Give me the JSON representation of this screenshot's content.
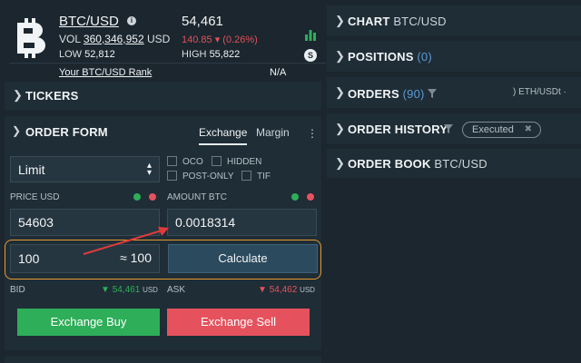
{
  "ticker": {
    "pair": "BTC/USD",
    "price": "54,461",
    "vol_label": "VOL",
    "vol_value": "360,346,952",
    "vol_unit": "USD",
    "change": "140.85 ▾ (0.26%)",
    "low_label": "LOW",
    "low_value": "52,812",
    "high_label": "HIGH",
    "high_value": "55,822",
    "rank_label": "Your BTC/USD Rank",
    "rank_value": "N/A",
    "s_icon": "S"
  },
  "tickers": {
    "title": "TICKERS"
  },
  "order_form": {
    "title": "ORDER FORM",
    "tabs": [
      "Exchange",
      "Margin"
    ],
    "order_type": "Limit",
    "options": [
      "OCO",
      "HIDDEN",
      "POST-ONLY",
      "TIF"
    ],
    "price_label": "PRICE USD",
    "price_value": "54603",
    "amount_label": "AMOUNT BTC",
    "amount_value": "0.0018314",
    "total_value": "100",
    "total_approx": "≈ 100",
    "calculate_label": "Calculate",
    "bid_label": "BID",
    "bid_value": "54,461",
    "bid_unit": "USD",
    "ask_label": "ASK",
    "ask_value": "54,462",
    "ask_unit": "USD",
    "buy_label": "Exchange Buy",
    "sell_label": "Exchange Sell"
  },
  "right": {
    "chart_title": "CHART",
    "chart_pair": "BTC/USD",
    "positions_title": "POSITIONS",
    "positions_count": "(0)",
    "orders_title": "ORDERS",
    "orders_count": "(90)",
    "orders_tag": ") ETH/USDt ·",
    "history_title": "ORDER HISTORY",
    "history_badge": "Executed",
    "book_title": "ORDER BOOK",
    "book_pair": "BTC/USD"
  },
  "colors": {
    "buy": "#2eae58",
    "sell": "#e5525d",
    "accent_link": "#5b9bd5",
    "highlight": "#e69a2e",
    "arrow": "#e03a3a"
  },
  "icons": [
    "bitcoin-logo-icon",
    "info-icon",
    "bar-chart-icon",
    "s-icon",
    "chevron-right-icon",
    "chevron-down-icon",
    "kebab-menu-icon",
    "filter-icon",
    "close-icon",
    "triangle-down-icon"
  ]
}
